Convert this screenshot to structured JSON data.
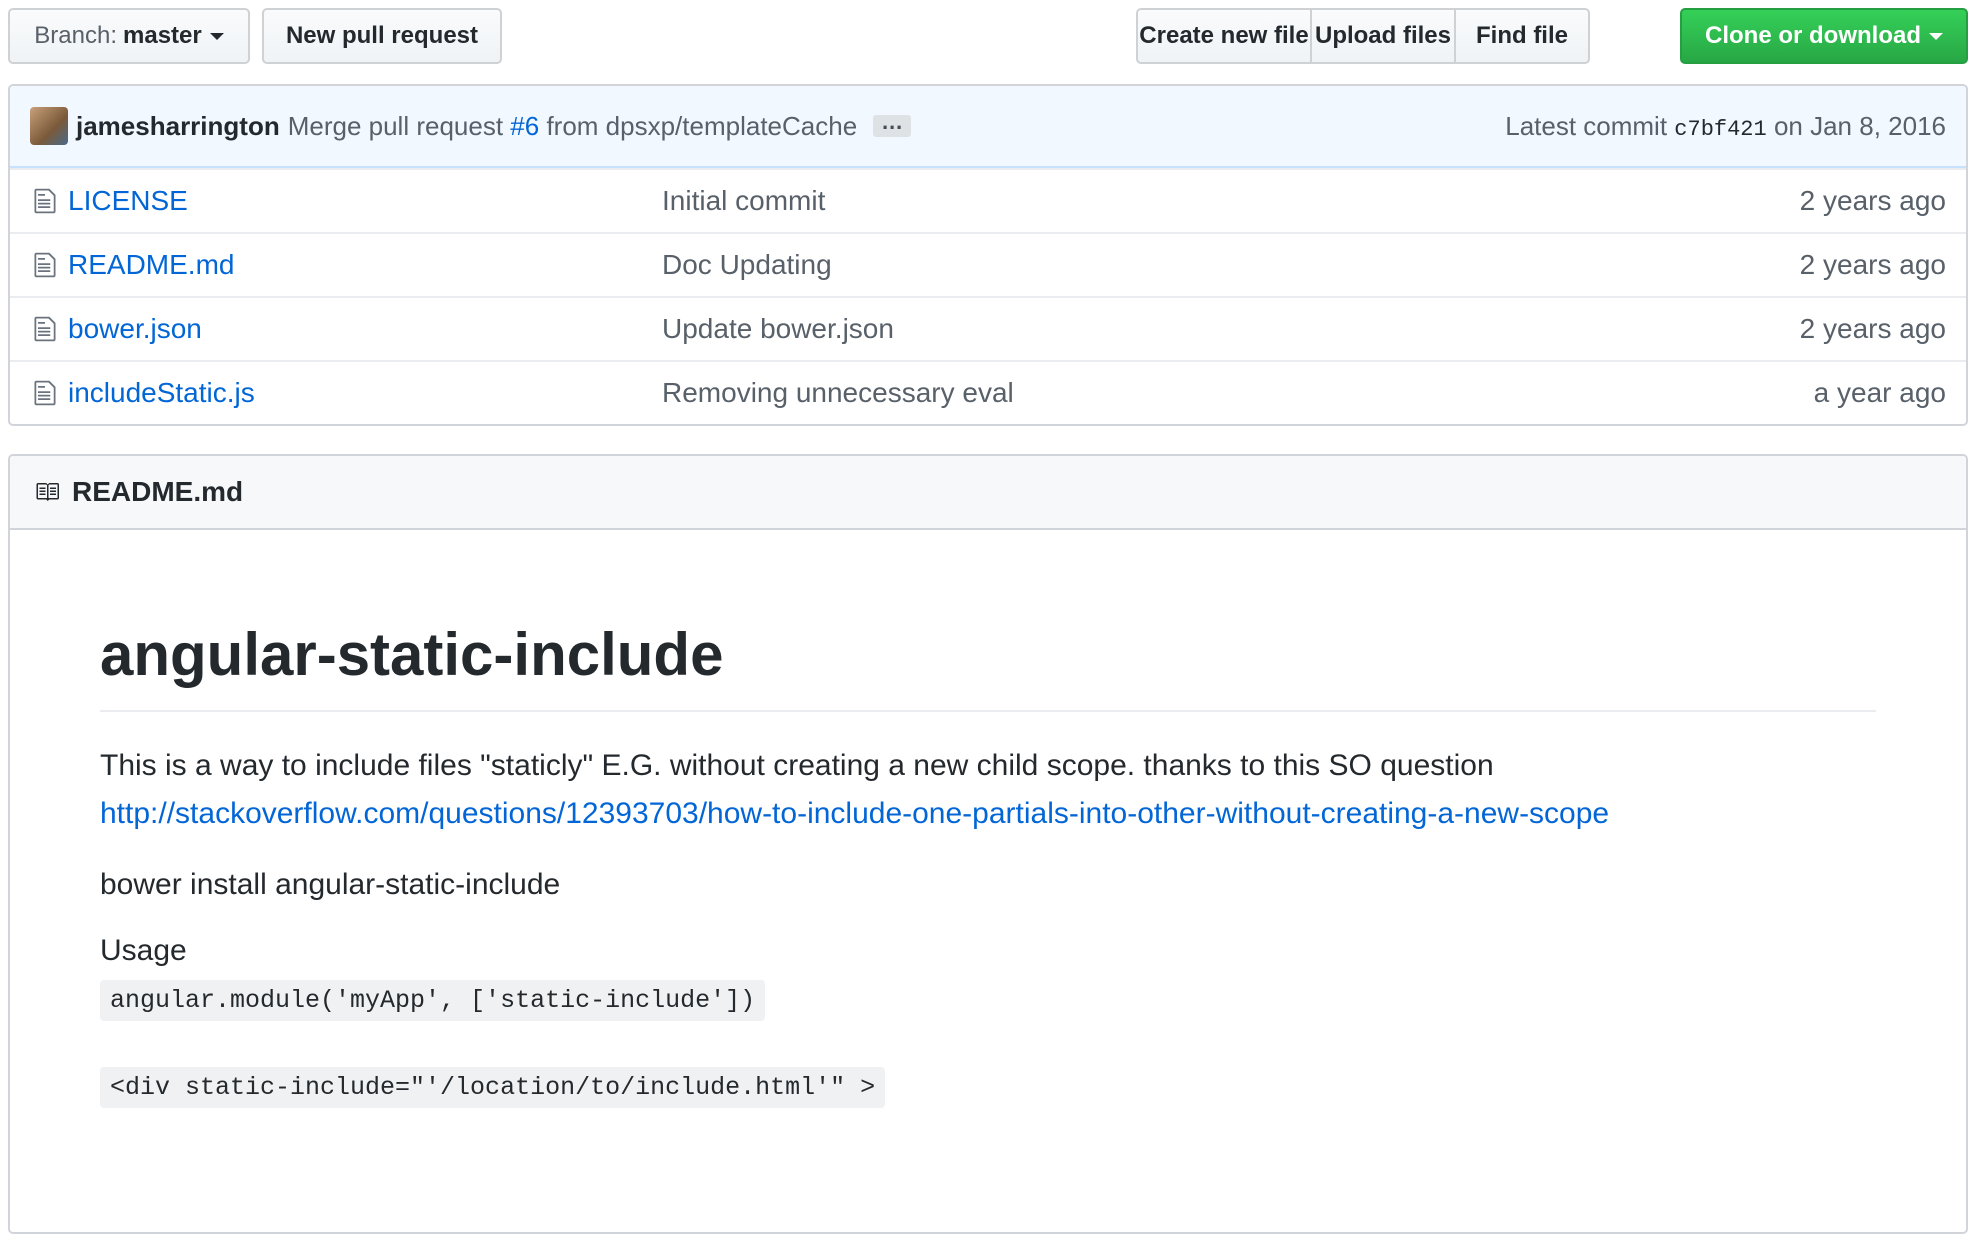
{
  "toolbar": {
    "branch_prefix": "Branch:",
    "branch_name": "master",
    "new_pull_request": "New pull request",
    "create_new_file": "Create new file",
    "upload_files": "Upload files",
    "find_file": "Find file",
    "clone_or_download": "Clone or download"
  },
  "commit": {
    "author": "jamesharrington",
    "message_prefix": "Merge pull request",
    "pr_number": "#6",
    "message_suffix": "from dpsxp/templateCache",
    "ellipsis": "…",
    "latest_label": "Latest commit",
    "sha": "c7bf421",
    "date_text": "on Jan 8, 2016"
  },
  "files": [
    {
      "name": "LICENSE",
      "message": "Initial commit",
      "age": "2 years ago"
    },
    {
      "name": "README.md",
      "message": "Doc Updating",
      "age": "2 years ago"
    },
    {
      "name": "bower.json",
      "message": "Update bower.json",
      "age": "2 years ago"
    },
    {
      "name": "includeStatic.js",
      "message": "Removing unnecessary eval",
      "age": "a year ago"
    }
  ],
  "readme": {
    "header": "README.md",
    "title": "angular-static-include",
    "intro": "This is a way to include files \"staticly\" E.G. without creating a new child scope. thanks to this SO question",
    "link": "http://stackoverflow.com/questions/12393703/how-to-include-one-partials-into-other-without-creating-a-new-scope",
    "install": "bower install angular-static-include",
    "usage_heading": "Usage",
    "code1": "angular.module('myApp', ['static-include'])",
    "code2": "<div static-include=\"'/location/to/include.html'\" >"
  },
  "colors": {
    "link": "#0366d6",
    "clone_button": "#28a745",
    "commit_bar_bg": "#f1f8ff"
  },
  "icons": {
    "file": "file-text-icon",
    "readme": "book-icon",
    "caret": "caret-down-icon"
  }
}
